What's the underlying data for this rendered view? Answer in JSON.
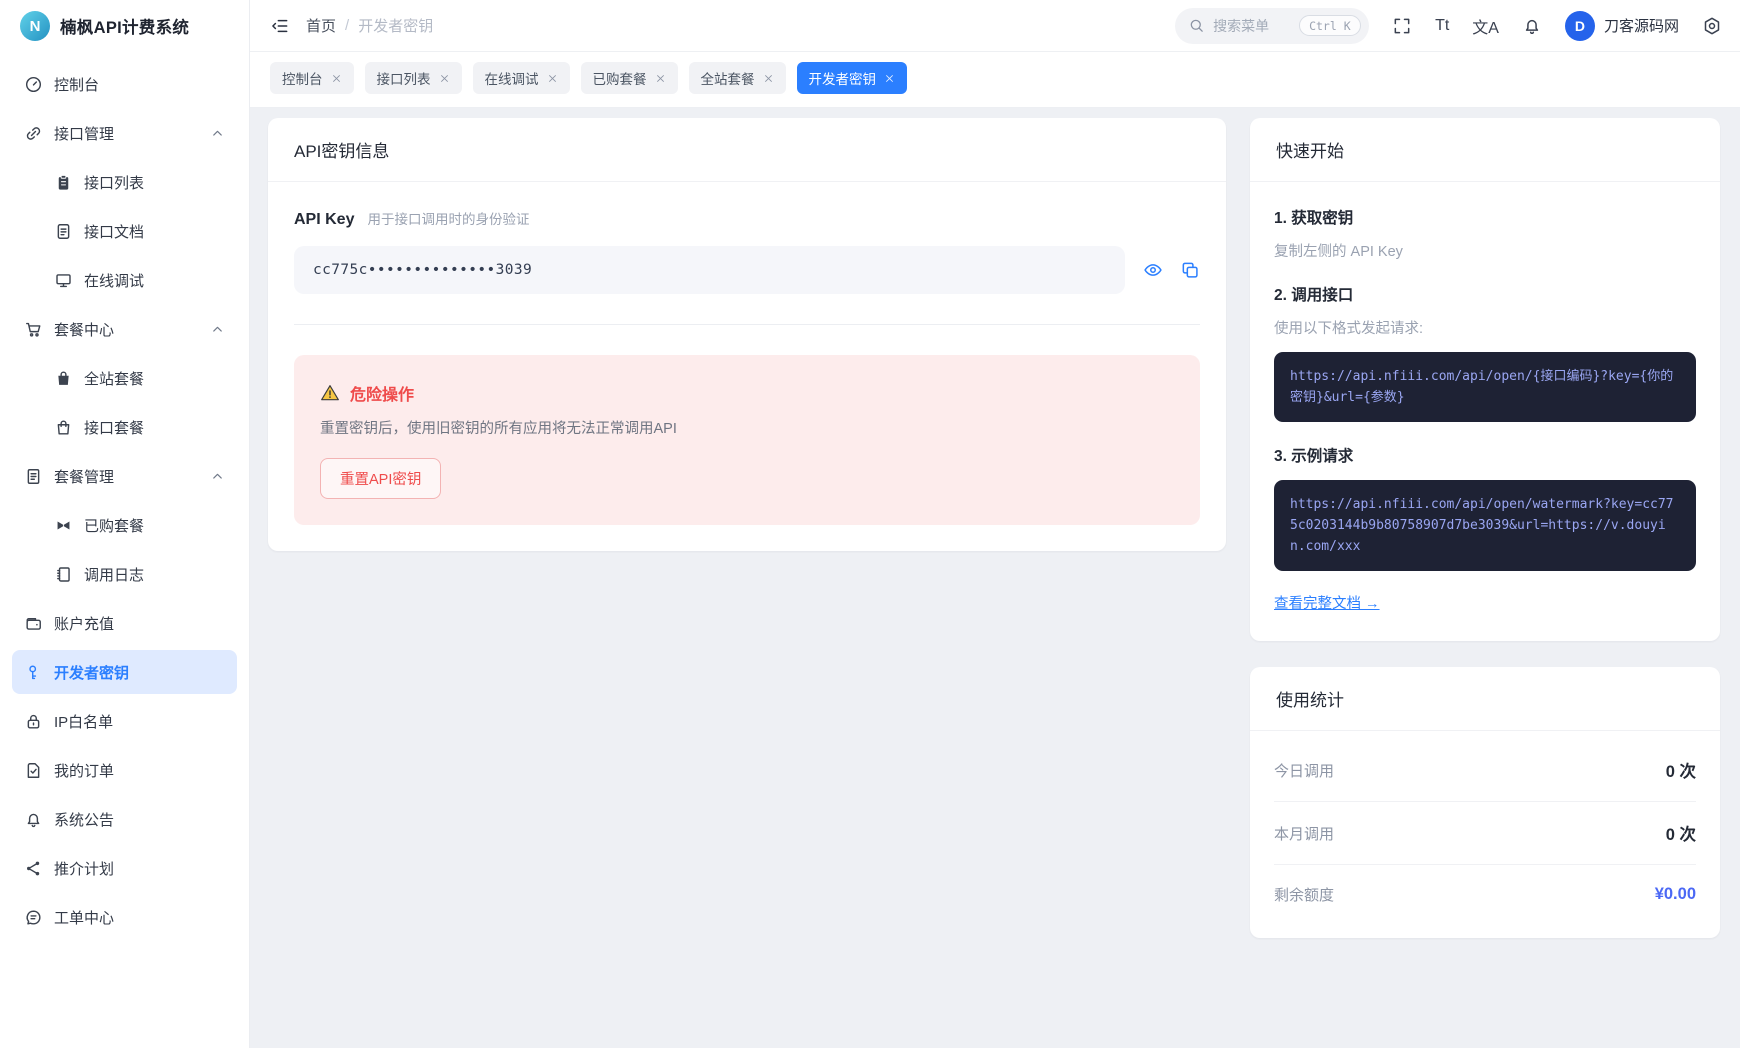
{
  "app": {
    "title": "楠枫API计费系统",
    "logo_letter": "N"
  },
  "topbar": {
    "breadcrumb": {
      "home": "首页",
      "separator": "/",
      "current": "开发者密钥"
    },
    "search": {
      "placeholder": "搜索菜单",
      "shortcut": "Ctrl K"
    },
    "icon_glyphs": {
      "font_size": "Tt",
      "locale": "文A"
    },
    "user": {
      "initial": "D",
      "name": "刀客源码网"
    }
  },
  "tabs": [
    {
      "label": "控制台"
    },
    {
      "label": "接口列表"
    },
    {
      "label": "在线调试"
    },
    {
      "label": "已购套餐"
    },
    {
      "label": "全站套餐"
    },
    {
      "label": "开发者密钥",
      "active": true
    }
  ],
  "sidebar": {
    "items": [
      {
        "label": "控制台",
        "icon": "gauge-icon"
      },
      {
        "label": "接口管理",
        "icon": "link-icon",
        "group": true
      },
      {
        "label": "接口列表",
        "icon": "clipboard-icon",
        "sub": true
      },
      {
        "label": "接口文档",
        "icon": "file-text-icon",
        "sub": true
      },
      {
        "label": "在线调试",
        "icon": "monitor-icon",
        "sub": true
      },
      {
        "label": "套餐中心",
        "icon": "cart-icon",
        "group": true
      },
      {
        "label": "全站套餐",
        "icon": "bag-solid-icon",
        "sub": true
      },
      {
        "label": "接口套餐",
        "icon": "bag-outline-icon",
        "sub": true
      },
      {
        "label": "套餐管理",
        "icon": "doc-lines-icon",
        "group": true
      },
      {
        "label": "已购套餐",
        "icon": "ticket-icon",
        "sub": true
      },
      {
        "label": "调用日志",
        "icon": "notebook-icon",
        "sub": true
      },
      {
        "label": "账户充值",
        "icon": "wallet-icon"
      },
      {
        "label": "开发者密钥",
        "icon": "key-icon",
        "active": true
      },
      {
        "label": "IP白名单",
        "icon": "lock-icon"
      },
      {
        "label": "我的订单",
        "icon": "file-check-icon"
      },
      {
        "label": "系统公告",
        "icon": "bell-icon"
      },
      {
        "label": "推介计划",
        "icon": "share-icon"
      },
      {
        "label": "工单中心",
        "icon": "chat-icon"
      }
    ]
  },
  "main": {
    "card_title": "API密钥信息",
    "api_key": {
      "label": "API Key",
      "desc": "用于接口调用时的身份验证",
      "masked_value": "cc775c••••••••••••••3039"
    },
    "danger": {
      "title": "危险操作",
      "desc": "重置密钥后，使用旧密钥的所有应用将无法正常调用API",
      "button": "重置API密钥"
    }
  },
  "quickstart": {
    "title": "快速开始",
    "steps": [
      {
        "title": "1. 获取密钥",
        "desc": "复制左侧的 API Key"
      },
      {
        "title": "2. 调用接口",
        "desc": "使用以下格式发起请求:",
        "code": "https://api.nfiii.com/api/open/{接口编码}?key={你的密钥}&url={参数}"
      },
      {
        "title": "3. 示例请求",
        "code": "https://api.nfiii.com/api/open/watermark?key=cc775c0203144b9b80758907d7be3039&url=https://v.douyin.com/xxx"
      }
    ],
    "doc_link": "查看完整文档 →"
  },
  "stats": {
    "title": "使用统计",
    "rows": [
      {
        "label": "今日调用",
        "value": "0 次"
      },
      {
        "label": "本月调用",
        "value": "0 次"
      },
      {
        "label": "剩余额度",
        "value": "¥0.00",
        "highlight": true
      }
    ]
  },
  "colors": {
    "accent": "#2b7fff",
    "sidebar_active_bg": "#dfeaff",
    "danger": "#ef4b4b",
    "danger_bg": "#fdecec",
    "code_bg": "#1e2234",
    "code_text": "#9aa6f2",
    "quota_value": "#4b68f5",
    "avatar_bg": "#2563eb"
  }
}
